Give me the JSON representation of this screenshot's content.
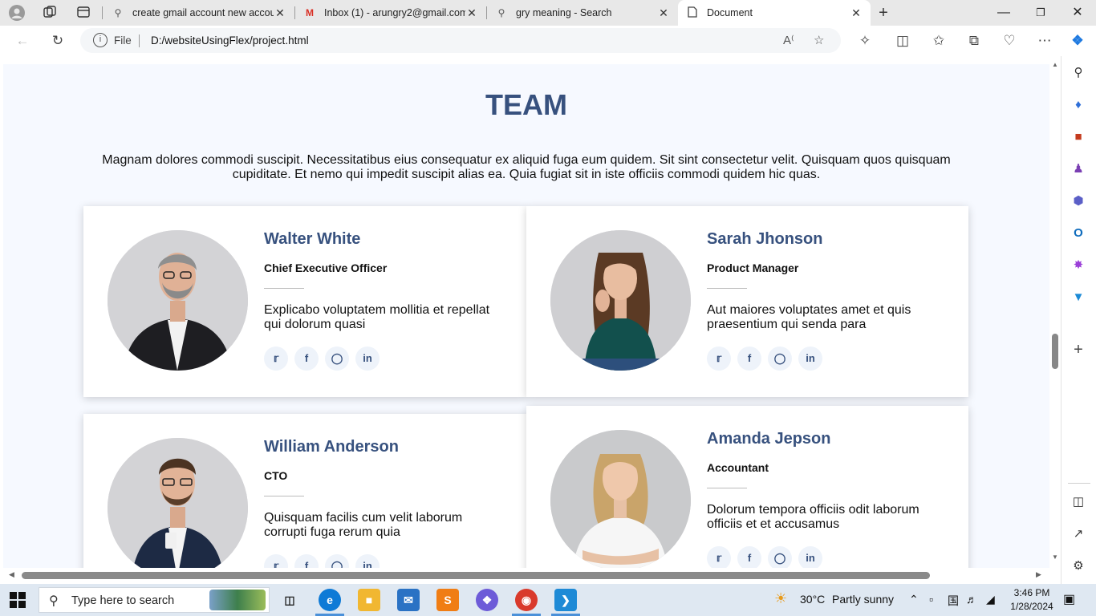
{
  "browser": {
    "tabs": [
      {
        "title": "create gmail account new accou",
        "icon": "search-icon"
      },
      {
        "title": "Inbox (1) - arungry2@gmail.com",
        "icon": "gmail-icon"
      },
      {
        "title": "gry meaning - Search",
        "icon": "search-icon"
      },
      {
        "title": "Document",
        "icon": "document-icon",
        "active": true
      }
    ],
    "address": {
      "scheme_label": "File",
      "url": "D:/websiteUsingFlex/project.html"
    }
  },
  "page": {
    "title": "TEAM",
    "description": "Magnam dolores commodi suscipit. Necessitatibus eius consequatur ex aliquid fuga eum quidem. Sit sint consectetur velit. Quisquam quos quisquam cupiditate. Et nemo qui impedit suscipit alias ea. Quia fugiat sit in iste officiis commodi quidem hic quas.",
    "members": [
      {
        "name": "Walter White",
        "role": "Chief Executive Officer",
        "bio": "Explicabo voluptatem mollitia et repellat qui dolorum quasi"
      },
      {
        "name": "Sarah Jhonson",
        "role": "Product Manager",
        "bio": "Aut maiores voluptates amet et quis praesentium qui senda para"
      },
      {
        "name": "William Anderson",
        "role": "CTO",
        "bio": "Quisquam facilis cum velit laborum corrupti fuga rerum quia"
      },
      {
        "name": "Amanda Jepson",
        "role": "Accountant",
        "bio": "Dolorum tempora officiis odit laborum officiis et et accusamus"
      }
    ],
    "social_icons": [
      "twitter-icon",
      "facebook-icon",
      "instagram-icon",
      "linkedin-icon"
    ],
    "colors": {
      "accent": "#37517e",
      "background": "#f6f9ff"
    }
  },
  "taskbar": {
    "search_placeholder": "Type here to search",
    "weather": {
      "temp": "30°C",
      "condition": "Partly sunny"
    },
    "time": "3:46 PM",
    "date": "1/28/2024"
  }
}
